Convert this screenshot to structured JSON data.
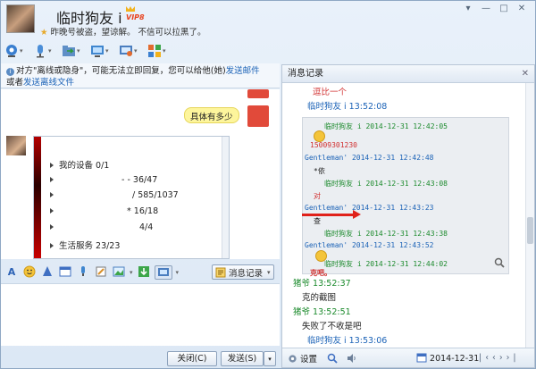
{
  "window": {
    "title": "临时狗友 i",
    "badge": "VIP8",
    "status_text": "昨晚号被盗，望谅解。  不信可以拉黑了。",
    "controls": [
      "▾",
      "—",
      "□",
      "✕"
    ]
  },
  "toolbar": {
    "items": [
      {
        "name": "video-call",
        "color": "#3a7fd0"
      },
      {
        "name": "voice-call",
        "color": "#4b8ed8"
      },
      {
        "name": "send-file",
        "color": "#4d9a4d"
      },
      {
        "name": "remote-desktop",
        "color": "#3f86cf"
      },
      {
        "name": "screen-share",
        "color": "#4a7dbf"
      },
      {
        "name": "apps",
        "color": "#e26b2f"
      }
    ]
  },
  "notice": {
    "text1": "对方\"离线或隐身\"，可能无法立即回复，您可以给他(她)",
    "link1": "发送邮件",
    "text2": "或者",
    "link2": "发送离线文件"
  },
  "chat": {
    "my_message": "具体有多少",
    "embedded_list": {
      "rows": [
        {
          "label": "我的设备 0/1"
        },
        {
          "label": "- - 36/47"
        },
        {
          "label": "/ 585/1037"
        },
        {
          "label": "* 16/18"
        },
        {
          "label": "4/4"
        },
        {
          "label": "生活服务 23/23"
        }
      ]
    }
  },
  "format_toolbar": {
    "font_label": "A",
    "message_record_button": "消息记录"
  },
  "buttons": {
    "close": "关闭(C)",
    "send": "发送(S)"
  },
  "history": {
    "title": "消息记录",
    "entries": [
      {
        "text": "逗比一个",
        "style": "red"
      },
      {
        "text": "临时狗友 i 13:52:08",
        "style": "blue"
      },
      {
        "text": "猪爷 13:52:37",
        "style": "green"
      },
      {
        "text": "克的截图",
        "style": "plain"
      },
      {
        "text": "猪爷 13:52:51",
        "style": "green"
      },
      {
        "text": "失败了不收是吧",
        "style": "plain"
      },
      {
        "text": "临时狗友 i 13:53:06",
        "style": "blue"
      }
    ],
    "screenshot_lines": [
      {
        "text": "临时狗友 i 2014-12-31 12:42:05",
        "style": "green"
      },
      {
        "text": "15009301230",
        "style": "red"
      },
      {
        "text": "Gentleman' 2014-12-31 12:42:48",
        "style": "blue"
      },
      {
        "text": "*依",
        "style": "plain"
      },
      {
        "text": "临时狗友 i 2014-12-31 12:43:08",
        "style": "green"
      },
      {
        "text": "对",
        "style": "red"
      },
      {
        "text": "Gentleman' 2014-12-31 12:43:23",
        "style": "blue"
      },
      {
        "text": "查",
        "style": "plain"
      },
      {
        "text": "临时狗友 i 2014-12-31 12:43:38",
        "style": "green"
      },
      {
        "text": "Gentleman' 2014-12-31 12:43:52",
        "style": "blue"
      },
      {
        "text": "临时狗友 i 2014-12-31 12:44:02",
        "style": "green"
      },
      {
        "text": "克吧。",
        "style": "red"
      }
    ],
    "footer": {
      "settings": "设置",
      "date": "2014-12-31"
    }
  }
}
